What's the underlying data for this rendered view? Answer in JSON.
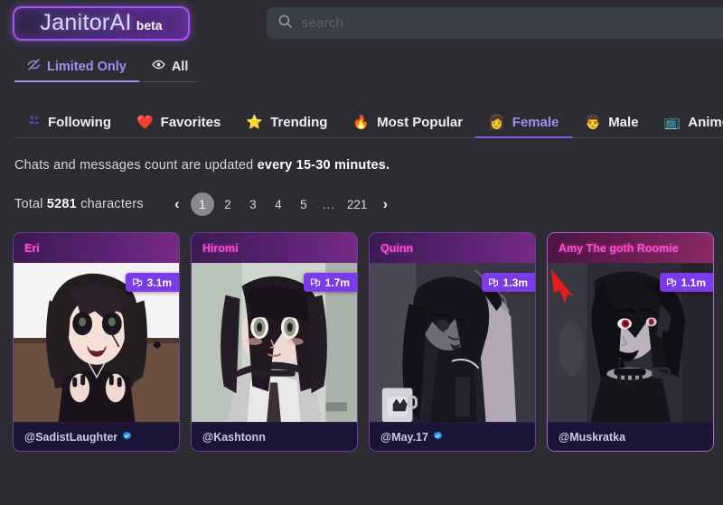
{
  "brand": {
    "name": "JanitorAI",
    "beta": "beta",
    "accent": "#a855f7"
  },
  "search": {
    "icon": "search-icon",
    "value": "search",
    "placeholder": "search"
  },
  "mode_tabs": [
    {
      "label": "Limited Only",
      "icon": "eye-off-icon",
      "active": true
    },
    {
      "label": "All",
      "icon": "eye-icon",
      "active": false
    }
  ],
  "category_tabs": [
    {
      "label": "Following",
      "emoji": "",
      "icon": "users-icon",
      "active": false
    },
    {
      "label": "Favorites",
      "emoji": "❤️",
      "active": false
    },
    {
      "label": "Trending",
      "emoji": "⭐",
      "active": false
    },
    {
      "label": "Most Popular",
      "emoji": "🔥",
      "active": false
    },
    {
      "label": "Female",
      "emoji": "👩",
      "active": true
    },
    {
      "label": "Male",
      "emoji": "👨",
      "active": false
    },
    {
      "label": "Anime",
      "emoji": "📺",
      "active": false
    }
  ],
  "notice": {
    "text_plain": "Chats and messages count are updated ",
    "text_bold": "every 15-30 minutes."
  },
  "total": {
    "prefix": "Total ",
    "count": "5281",
    "suffix": " characters"
  },
  "pagination": {
    "prev": "‹",
    "next": "›",
    "pages": [
      "1",
      "2",
      "3",
      "4",
      "5",
      "...",
      "221"
    ],
    "active_page": "1"
  },
  "cards": [
    {
      "name": "Eri",
      "messages": "3.1m",
      "handle": "@SadistLaughter",
      "verified": true,
      "highlighted": false,
      "art": "anime-girl-black-hair-smiling"
    },
    {
      "name": "Hiromi",
      "messages": "1.7m",
      "handle": "@Kashtonn",
      "verified": false,
      "highlighted": false,
      "art": "anime-girl-school-uniform"
    },
    {
      "name": "Quinn",
      "messages": "1.3m",
      "handle": "@May.17",
      "verified": true,
      "highlighted": false,
      "art": "anime-girl-greyscale-mug"
    },
    {
      "name": "Amy The goth Roomie",
      "messages": "1.1m",
      "handle": "@Muskratka",
      "verified": false,
      "highlighted": true,
      "art": "goth-girl-dark-portrait"
    }
  ],
  "annotation": {
    "type": "red-arrow",
    "color": "#ee1c17",
    "points_to": "Amy The goth Roomie"
  }
}
